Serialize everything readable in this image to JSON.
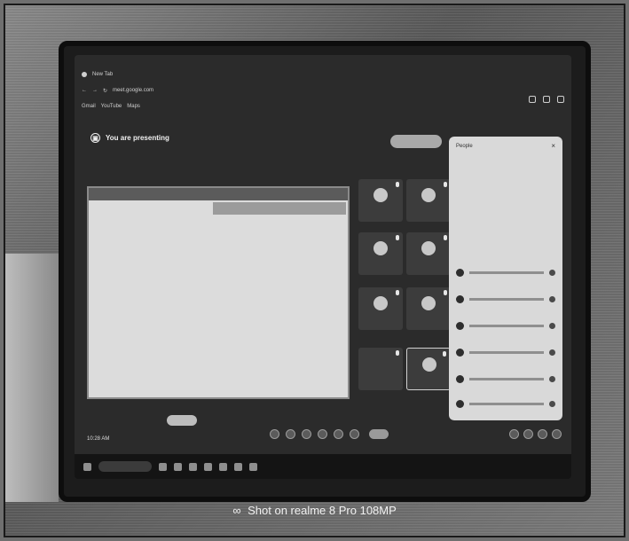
{
  "browser": {
    "address": "meet.google.com",
    "tabs": [
      "New Tab"
    ],
    "bookmarks": [
      "Gmail",
      "YouTube",
      "Maps"
    ]
  },
  "banner": {
    "text": "You are presenting"
  },
  "tiles": [
    {
      "name": "",
      "has_avatar": true
    },
    {
      "name": "",
      "has_avatar": true
    },
    {
      "name": "",
      "has_avatar": true
    },
    {
      "name": "",
      "has_avatar": true
    },
    {
      "name": "",
      "has_avatar": true
    },
    {
      "name": "",
      "has_avatar": true
    },
    {
      "name": "",
      "has_avatar": false
    },
    {
      "name": "",
      "has_avatar": true
    }
  ],
  "panel": {
    "title": "People",
    "close": "×"
  },
  "meeting": {
    "time": "10:28 AM"
  },
  "watermark": {
    "text": "Shot on realme 8 Pro 108MP"
  }
}
